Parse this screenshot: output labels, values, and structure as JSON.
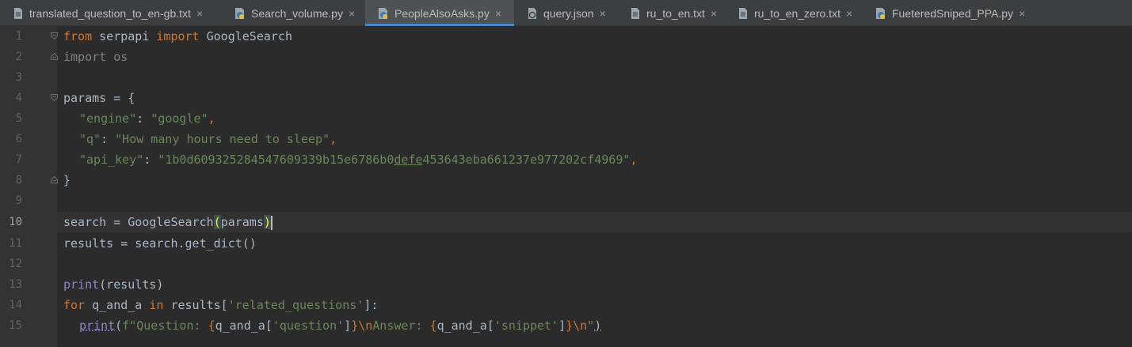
{
  "tabs": [
    {
      "label": "translated_question_to_en-gb.txt",
      "icon": "text-file-icon",
      "active": false
    },
    {
      "label": "Search_volume.py",
      "icon": "python-file-icon",
      "active": false
    },
    {
      "label": "PeopleAlsoAsks.py",
      "icon": "python-file-icon",
      "active": true
    },
    {
      "label": "query.json",
      "icon": "json-file-icon",
      "active": false
    },
    {
      "label": "ru_to_en.txt",
      "icon": "text-file-icon",
      "active": false
    },
    {
      "label": "ru_to_en_zero.txt",
      "icon": "text-file-icon",
      "active": false
    },
    {
      "label": "FueteredSniped_PPA.py",
      "icon": "python-file-icon",
      "active": false
    }
  ],
  "close_glyph": "×",
  "editor": {
    "current_line": 10,
    "line_numbers": [
      "1",
      "2",
      "3",
      "4",
      "5",
      "6",
      "7",
      "8",
      "9",
      "10",
      "11",
      "12",
      "13",
      "14",
      "15"
    ],
    "code": {
      "l1_from": "from",
      "l1_mod": " serpapi ",
      "l1_import": "import",
      "l1_name": " GoogleSearch",
      "l2_import": "import",
      "l2_os": " os",
      "l4_a": "params = {",
      "l5_k": "\"engine\"",
      "l5_c": ": ",
      "l5_v": "\"google\"",
      "l5_e": ",",
      "l6_k": "\"q\"",
      "l6_c": ": ",
      "l6_v": "\"How many hours need to sleep\"",
      "l6_e": ",",
      "l7_k": "\"api_key\"",
      "l7_c": ": ",
      "l7_v1": "\"1b0d609325284547609339b15e6786b0",
      "l7_v2": "defe",
      "l7_v3": "453643eba661237e977202cf4969\"",
      "l7_e": ",",
      "l8_a": "}",
      "l10_a": "search = GoogleSearch",
      "l10_b": "(",
      "l10_c": "params",
      "l10_d": ")",
      "l11_a": "results = search.get_dict()",
      "l13_print": "print",
      "l13_rest": "(results)",
      "l14_for": "for",
      "l14_var": " q_and_a ",
      "l14_in": "in",
      "l14_res": " results[",
      "l14_str": "'related_questions'",
      "l14_end": "]:",
      "l15_print": "print",
      "l15_p": "(",
      "l15_f": "f\"Question: ",
      "l15_b1": "{",
      "l15_e1": "q_and_a[",
      "l15_s1": "'question'",
      "l15_e2": "]",
      "l15_b2": "}",
      "l15_nl1": "\\n",
      "l15_ans": "Answer: ",
      "l15_b3": "{",
      "l15_e3": "q_and_a[",
      "l15_s2": "'snippet'",
      "l15_e4": "]",
      "l15_b4": "}",
      "l15_nl2": "\\n",
      "l15_q": "\"",
      "l15_close": ")"
    }
  },
  "colors": {
    "keyword": "#cc7832",
    "string": "#6a8759",
    "builtin": "#8888c6",
    "text": "#a9b7c6",
    "accent": "#4a88c7"
  }
}
